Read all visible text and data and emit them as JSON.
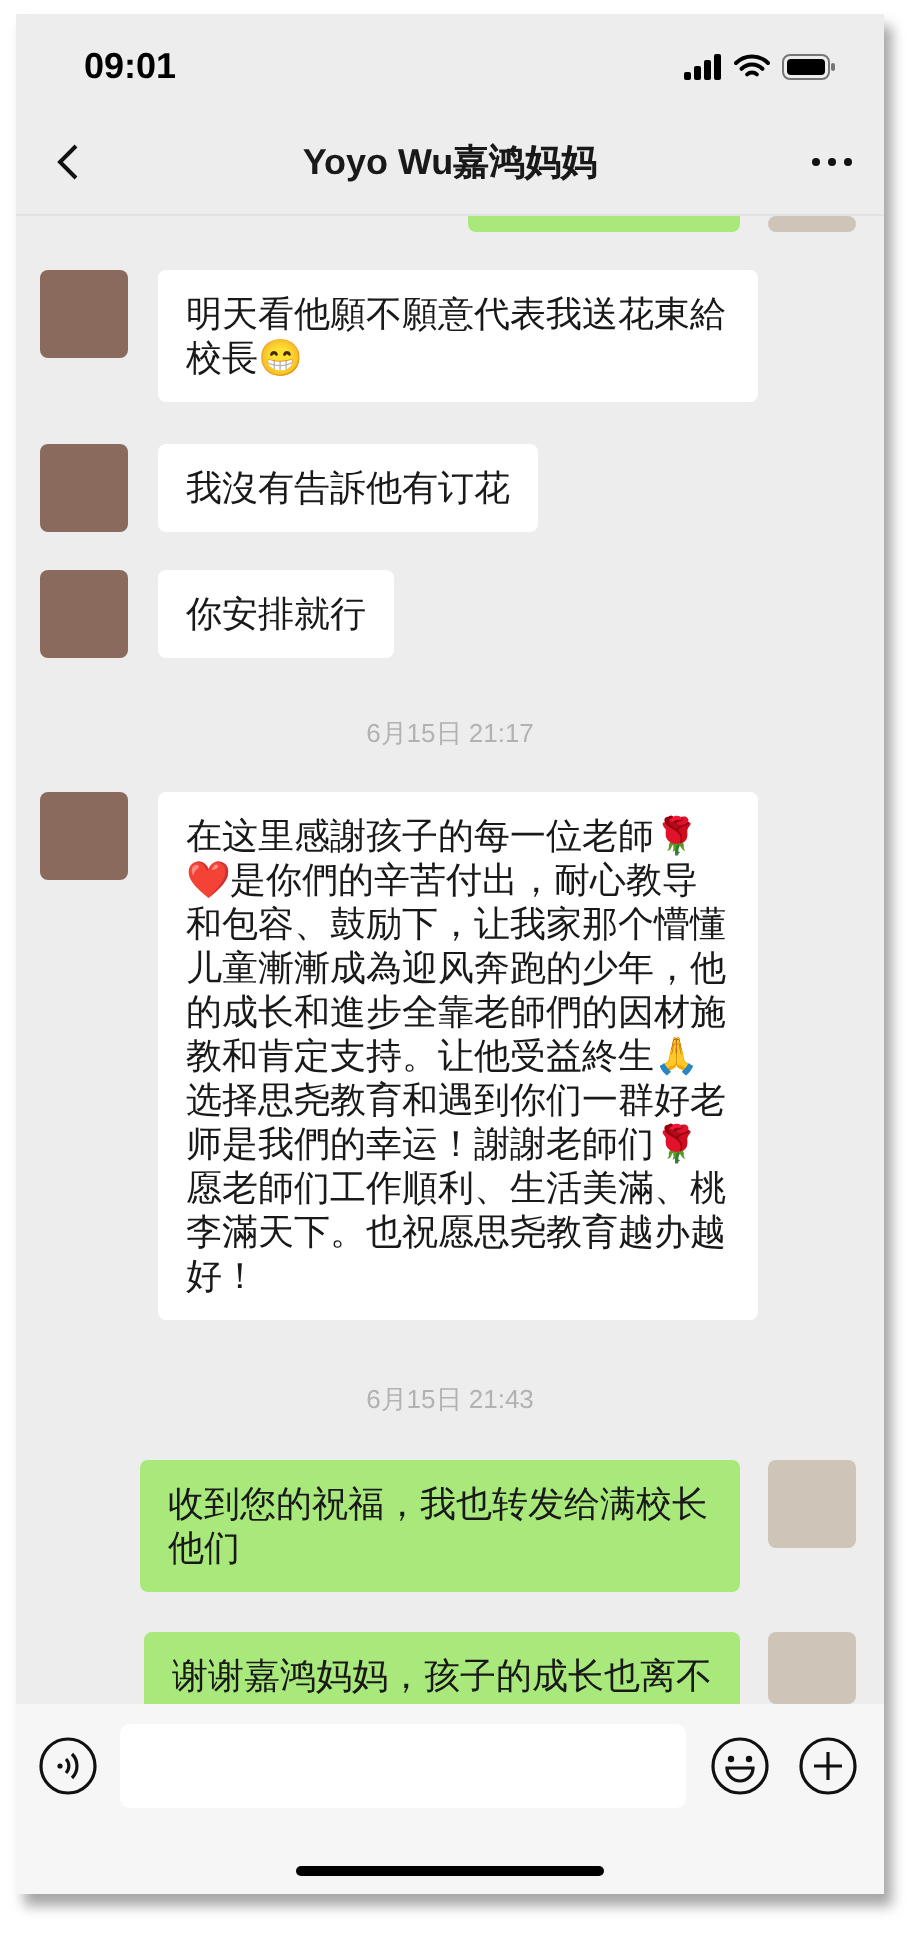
{
  "status_bar": {
    "time": "09:01"
  },
  "header": {
    "title": "Yoyo Wu嘉鸿妈妈"
  },
  "messages": [
    {
      "kind": "cut_top",
      "outgoing": true
    },
    {
      "kind": "text",
      "outgoing": false,
      "text": "明天看他願不願意代表我送花東給校長😁"
    },
    {
      "kind": "text",
      "outgoing": false,
      "text": "我沒有告訴他有订花"
    },
    {
      "kind": "text",
      "outgoing": false,
      "text": "你安排就行"
    },
    {
      "kind": "time",
      "text": "6月15日 21:17"
    },
    {
      "kind": "text",
      "outgoing": false,
      "text": "在这里感謝孩子的每一位老師🌹❤️是你們的辛苦付出，耐心教导和包容、鼓励下，让我家那个懵懂儿童漸漸成為迎风奔跑的少年，他的成长和進步全靠老師們的因材施教和肯定支持。让他受益終生🙏选择思尧教育和遇到你们一群好老师是我們的幸运！謝謝老師们🌹愿老師们工作順利、生活美滿、桃李滿天下。也祝愿思尧教育越办越好！"
    },
    {
      "kind": "time",
      "text": "6月15日 21:43"
    },
    {
      "kind": "text",
      "outgoing": true,
      "text": "收到您的祝福，我也转发给满校长他们"
    },
    {
      "kind": "cut_bottom",
      "outgoing": true,
      "text": "谢谢嘉鸿妈妈，孩子的成长也离不"
    }
  ]
}
